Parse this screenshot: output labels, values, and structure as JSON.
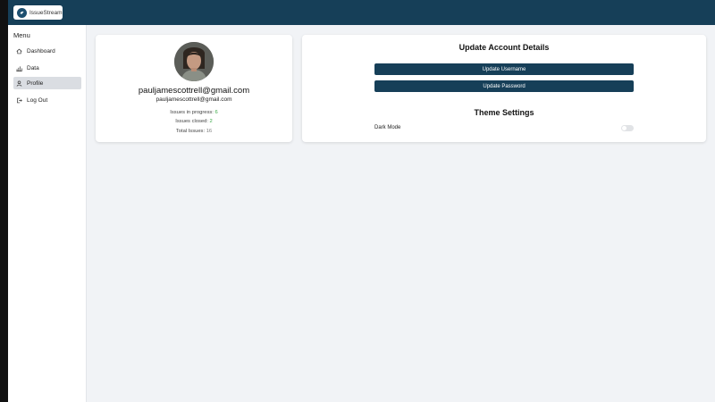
{
  "header": {
    "app_name": "IssueStream",
    "logo_icon": "bird-logo-icon",
    "background_color": "#163f58"
  },
  "sidebar": {
    "menu_title": "Menu",
    "items": [
      {
        "label": "Dashboard",
        "icon": "home-icon",
        "active": false
      },
      {
        "label": "Data",
        "icon": "bar-chart-icon",
        "active": false
      },
      {
        "label": "Profile",
        "icon": "user-icon",
        "active": true
      },
      {
        "label": "Log Out",
        "icon": "logout-icon",
        "active": false
      }
    ]
  },
  "profile": {
    "name": "pauljamescottrell@gmail.com",
    "email": "pauljamescottrell@gmail.com",
    "stats": {
      "in_progress_label": "Issues in progress: ",
      "in_progress_value": "6",
      "closed_label": "Issues closed: ",
      "closed_value": "2",
      "total_label": "Total Issues: ",
      "total_value": "16"
    },
    "accent_color": "#39a845"
  },
  "account": {
    "title": "Update Account Details",
    "update_username_label": "Update Username",
    "update_password_label": "Update Password",
    "button_color": "#163f58"
  },
  "theme": {
    "title": "Theme Settings",
    "dark_mode_label": "Dark Mode",
    "dark_mode_enabled": false
  }
}
